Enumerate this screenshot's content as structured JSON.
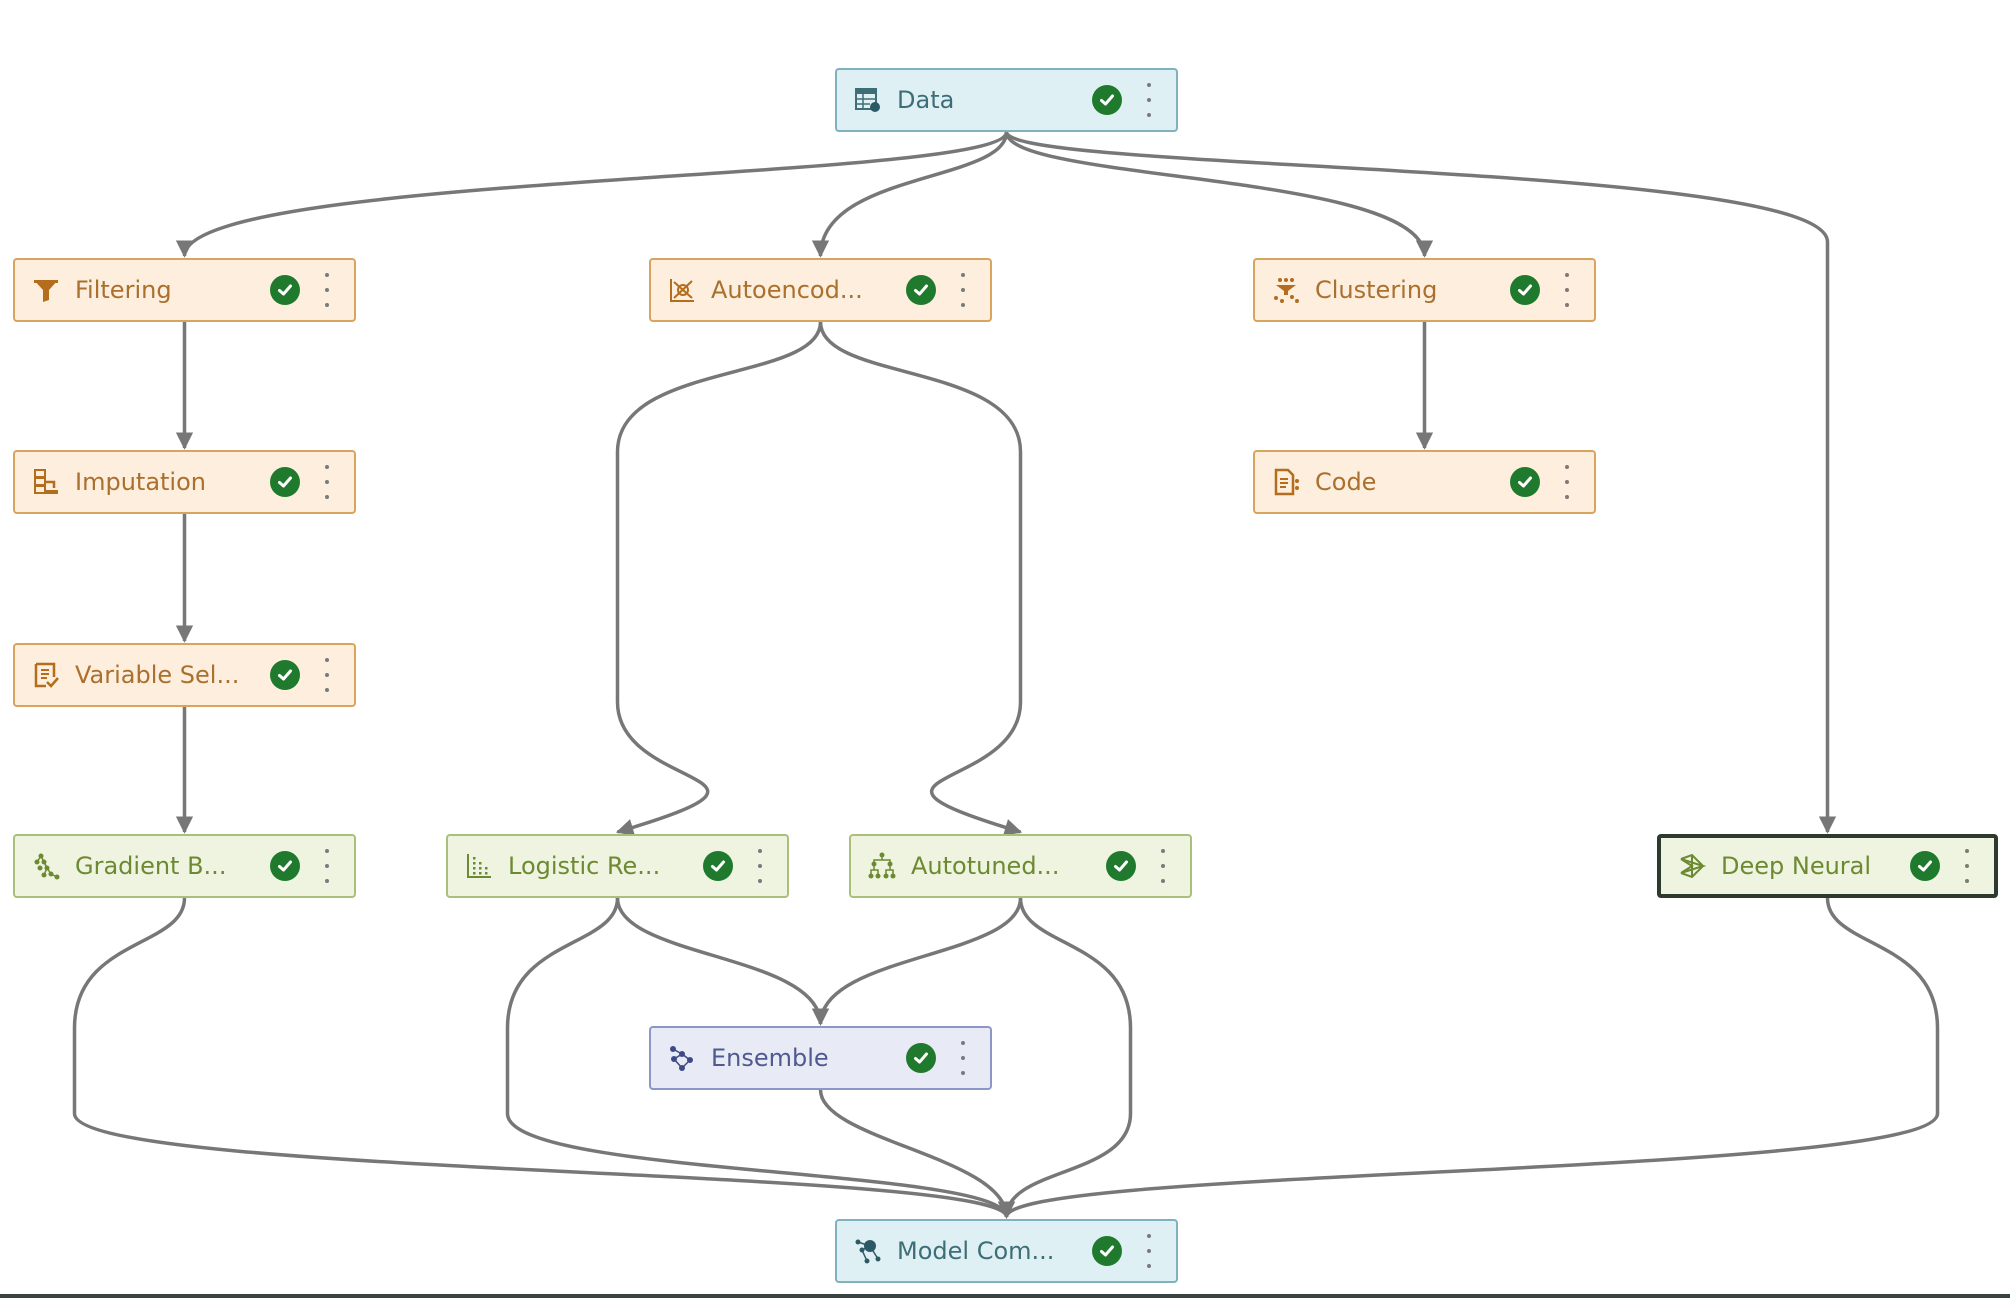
{
  "pipeline": {
    "colors": {
      "edge": "#777777",
      "status_ok": "#1f7a2e",
      "data_fill": "#dff0f4",
      "prep_fill": "#fdeedd",
      "model_fill": "#eef4df",
      "ensemble_fill": "#e8ebf6",
      "selected_border": "#2e3a2e"
    },
    "nodes": [
      {
        "id": "data",
        "label": "Data",
        "kind": "data",
        "icon": "data-table-icon",
        "status": "success",
        "selected": false
      },
      {
        "id": "filtering",
        "label": "Filtering",
        "kind": "prep",
        "icon": "funnel-filter-icon",
        "status": "success",
        "selected": false
      },
      {
        "id": "autoencoder",
        "label": "Autoencod...",
        "kind": "prep",
        "icon": "autoencoder-chart-icon",
        "status": "success",
        "selected": false
      },
      {
        "id": "clustering",
        "label": "Clustering",
        "kind": "prep",
        "icon": "clustering-icon",
        "status": "success",
        "selected": false
      },
      {
        "id": "imputation",
        "label": "Imputation",
        "kind": "prep",
        "icon": "imputation-icon",
        "status": "success",
        "selected": false
      },
      {
        "id": "code",
        "label": "Code",
        "kind": "prep",
        "icon": "code-document-icon",
        "status": "success",
        "selected": false
      },
      {
        "id": "varsel",
        "label": "Variable Sel...",
        "kind": "prep",
        "icon": "variable-selection-icon",
        "status": "success",
        "selected": false
      },
      {
        "id": "gradient",
        "label": "Gradient B...",
        "kind": "model",
        "icon": "gradient-boosting-icon",
        "status": "success",
        "selected": false
      },
      {
        "id": "logistic",
        "label": "Logistic Re...",
        "kind": "model",
        "icon": "logistic-regression-icon",
        "status": "success",
        "selected": false
      },
      {
        "id": "autotuned",
        "label": "Autotuned...",
        "kind": "model",
        "icon": "decision-tree-icon",
        "status": "success",
        "selected": false
      },
      {
        "id": "deepneural",
        "label": "Deep Neural",
        "kind": "model",
        "icon": "neural-network-icon",
        "status": "success",
        "selected": true
      },
      {
        "id": "ensemble",
        "label": "Ensemble",
        "kind": "ensemble",
        "icon": "ensemble-icon",
        "status": "success",
        "selected": false
      },
      {
        "id": "modelcomp",
        "label": "Model Com...",
        "kind": "data",
        "icon": "model-comparison-icon",
        "status": "success",
        "selected": false
      }
    ],
    "edges": [
      [
        "data",
        "filtering"
      ],
      [
        "data",
        "autoencoder"
      ],
      [
        "data",
        "clustering"
      ],
      [
        "data",
        "deepneural"
      ],
      [
        "filtering",
        "imputation"
      ],
      [
        "imputation",
        "varsel"
      ],
      [
        "varsel",
        "gradient"
      ],
      [
        "autoencoder",
        "logistic"
      ],
      [
        "autoencoder",
        "autotuned"
      ],
      [
        "clustering",
        "code"
      ],
      [
        "logistic",
        "ensemble"
      ],
      [
        "autotuned",
        "ensemble"
      ],
      [
        "gradient",
        "modelcomp"
      ],
      [
        "logistic",
        "modelcomp"
      ],
      [
        "ensemble",
        "modelcomp"
      ],
      [
        "autotuned",
        "modelcomp"
      ],
      [
        "deepneural",
        "modelcomp"
      ]
    ]
  }
}
